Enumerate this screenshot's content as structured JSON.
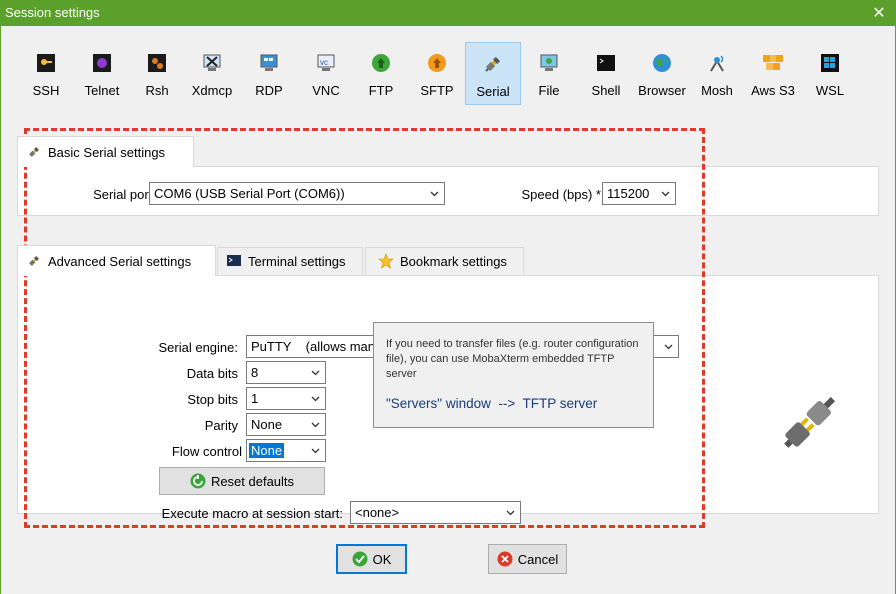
{
  "window": {
    "title": "Session settings",
    "close_glyph": "✕"
  },
  "toolbar": {
    "items": [
      {
        "label": "SSH",
        "icon": "ssh-icon"
      },
      {
        "label": "Telnet",
        "icon": "telnet-icon"
      },
      {
        "label": "Rsh",
        "icon": "rsh-icon"
      },
      {
        "label": "Xdmcp",
        "icon": "xdmcp-icon"
      },
      {
        "label": "RDP",
        "icon": "rdp-icon"
      },
      {
        "label": "VNC",
        "icon": "vnc-icon"
      },
      {
        "label": "FTP",
        "icon": "ftp-icon"
      },
      {
        "label": "SFTP",
        "icon": "sftp-icon"
      },
      {
        "label": "Serial",
        "icon": "serial-plug-icon",
        "active": true
      },
      {
        "label": "File",
        "icon": "file-icon"
      },
      {
        "label": "Shell",
        "icon": "shell-icon"
      },
      {
        "label": "Browser",
        "icon": "browser-globe-icon"
      },
      {
        "label": "Mosh",
        "icon": "mosh-antenna-icon"
      },
      {
        "label": "Aws S3",
        "icon": "aws-s3-icon"
      },
      {
        "label": "WSL",
        "icon": "wsl-windows-icon"
      }
    ]
  },
  "basic": {
    "tab_label": "Basic Serial settings",
    "serial_port_label": "Serial port *",
    "serial_port_value": "COM6  (USB Serial Port (COM6))",
    "speed_label": "Speed (bps) *",
    "speed_value": "115200"
  },
  "advanced": {
    "tabs": [
      {
        "label": "Advanced Serial settings",
        "active": true
      },
      {
        "label": "Terminal settings"
      },
      {
        "label": "Bookmark settings"
      }
    ],
    "engine_label": "Serial engine:",
    "engine_value": "PuTTY    (allows manual COM port setting)",
    "data_bits_label": "Data bits",
    "data_bits_value": "8",
    "stop_bits_label": "Stop bits",
    "stop_bits_value": "1",
    "parity_label": "Parity",
    "parity_value": "None",
    "flow_control_label": "Flow control",
    "flow_control_value": "None",
    "reset_label": "Reset defaults",
    "macro_label": "Execute macro at session start:",
    "macro_value": "<none>",
    "info_text": "If you need to transfer files (e.g. router configuration file), you can use MobaXterm embedded TFTP server",
    "info_highlight": "\"Servers\" window  -->  TFTP server"
  },
  "footer": {
    "ok_label": "OK",
    "cancel_label": "Cancel"
  },
  "colors": {
    "titlebar": "#5aa02a",
    "highlight_dash": "#e03a2a",
    "selection": "#0078d7"
  }
}
